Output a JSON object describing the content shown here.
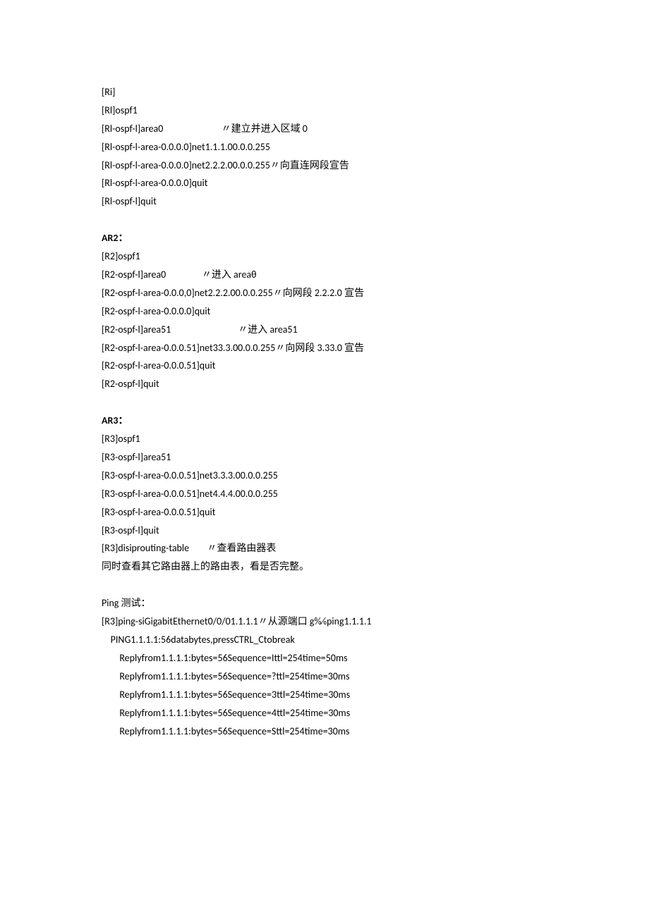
{
  "lines": [
    {
      "text": "[Ri]"
    },
    {
      "text": "[Rl]ospf1"
    },
    {
      "text": "[Rl-ospf-l]area0                          〃建立并进入区域 0"
    },
    {
      "text": "[Rl-ospf-l-area-0.0.0.0]net1.1.1.00.0.0.255"
    },
    {
      "text": "[Rl-ospf-l-area-0.0.0.0]net2.2.2.00.0.0.255〃向直连网段宣告"
    },
    {
      "text": "[Rl-ospf-l-area-0.0.0.0]quit"
    },
    {
      "text": "[Rl-ospf-l]quit"
    },
    {
      "gap": true
    },
    {
      "text": "AR2：",
      "bold": true
    },
    {
      "text": "[R2]ospf1"
    },
    {
      "text": "[R2-ospf-l]area0                〃进入 areaθ"
    },
    {
      "text": "[R2-ospf-l-area-0.0.0,0]net2.2.2.00.0.0.255〃向网段 2.2.2.0 宣告"
    },
    {
      "text": "[R2-ospf-l-area-0.0.0.0]quit"
    },
    {
      "text": "[R2-ospf-l]area51                              〃进入 area51"
    },
    {
      "text": "[R2-ospf-l-area-0.0.0.51]net33.3.00.0.0.255〃向网段 3.33.0 宣告"
    },
    {
      "text": "[R2-ospf-l-area-0.0.0.51]quit"
    },
    {
      "text": "[R2-ospf-l]quit"
    },
    {
      "gap": true
    },
    {
      "text": "AR3：",
      "bold": true
    },
    {
      "text": "[R3]ospf1"
    },
    {
      "text": "[R3-ospf-l]area51"
    },
    {
      "text": "[R3-ospf-l-area-0.0.0.51]net3.3.3.00.0.0.255"
    },
    {
      "text": "[R3-ospf-l-area-0.0.0.51]net4.4.4.00.0.0.255"
    },
    {
      "text": "[R3-ospf-l-area-0.0.0.51]quit"
    },
    {
      "text": "[R3-ospf-l]quit"
    },
    {
      "text": "[R3]disiprouting-table        〃查看路由器表"
    },
    {
      "text": "同时查看其它路由器上的路由表，看是否完整。"
    },
    {
      "gap": true
    },
    {
      "text": "Ping 测试："
    },
    {
      "text": "[R3]ping-siGigabitEthernet0/0/01.1.1.1〃从源端口 g0⁄0⁄0ping1.1.1.1"
    },
    {
      "text": "    PING1.1.1.1:56databytes,pressCTRL_Ctobreak"
    },
    {
      "text": "        Replyfrom1.1.1.1:bytes=56Sequence=Ittl=254time=50ms"
    },
    {
      "text": "        Replyfrom1.1.1.1:bytes=56Sequence=?ttl=254time=30ms"
    },
    {
      "text": "        Replyfrom1.1.1.1:bytes=56Sequence=3ttl=254time=30ms"
    },
    {
      "text": "        Replyfrom1.1.1.1:bytes=56Sequence=4ttl=254time=30ms"
    },
    {
      "text": "        Replyfrom1.1.1.1:bytes=56Sequence=Sttl=254time=30ms"
    }
  ]
}
